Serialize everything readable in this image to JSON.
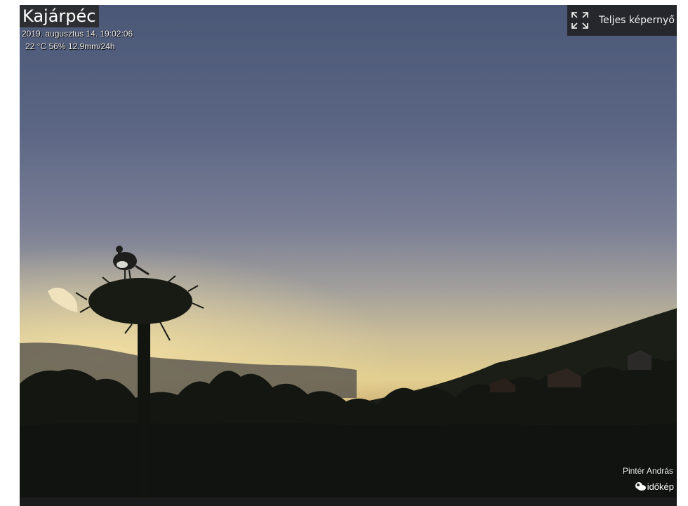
{
  "webcam": {
    "title": "Kajárpéc",
    "datetime": "2019. augusztus 14. 19:02:06",
    "weather": "22 °C 56% 12.9mm/24h",
    "author": "Pintér András",
    "brand": "időkép"
  },
  "controls": {
    "fullscreen_label": "Teljes képernyő",
    "fullscreen_icon": "expand-icon"
  },
  "colors": {
    "sky_top": "#4a5775",
    "sky_horizon": "#e6cf8c",
    "silhouette": "#141711",
    "overlay": "#282828"
  }
}
